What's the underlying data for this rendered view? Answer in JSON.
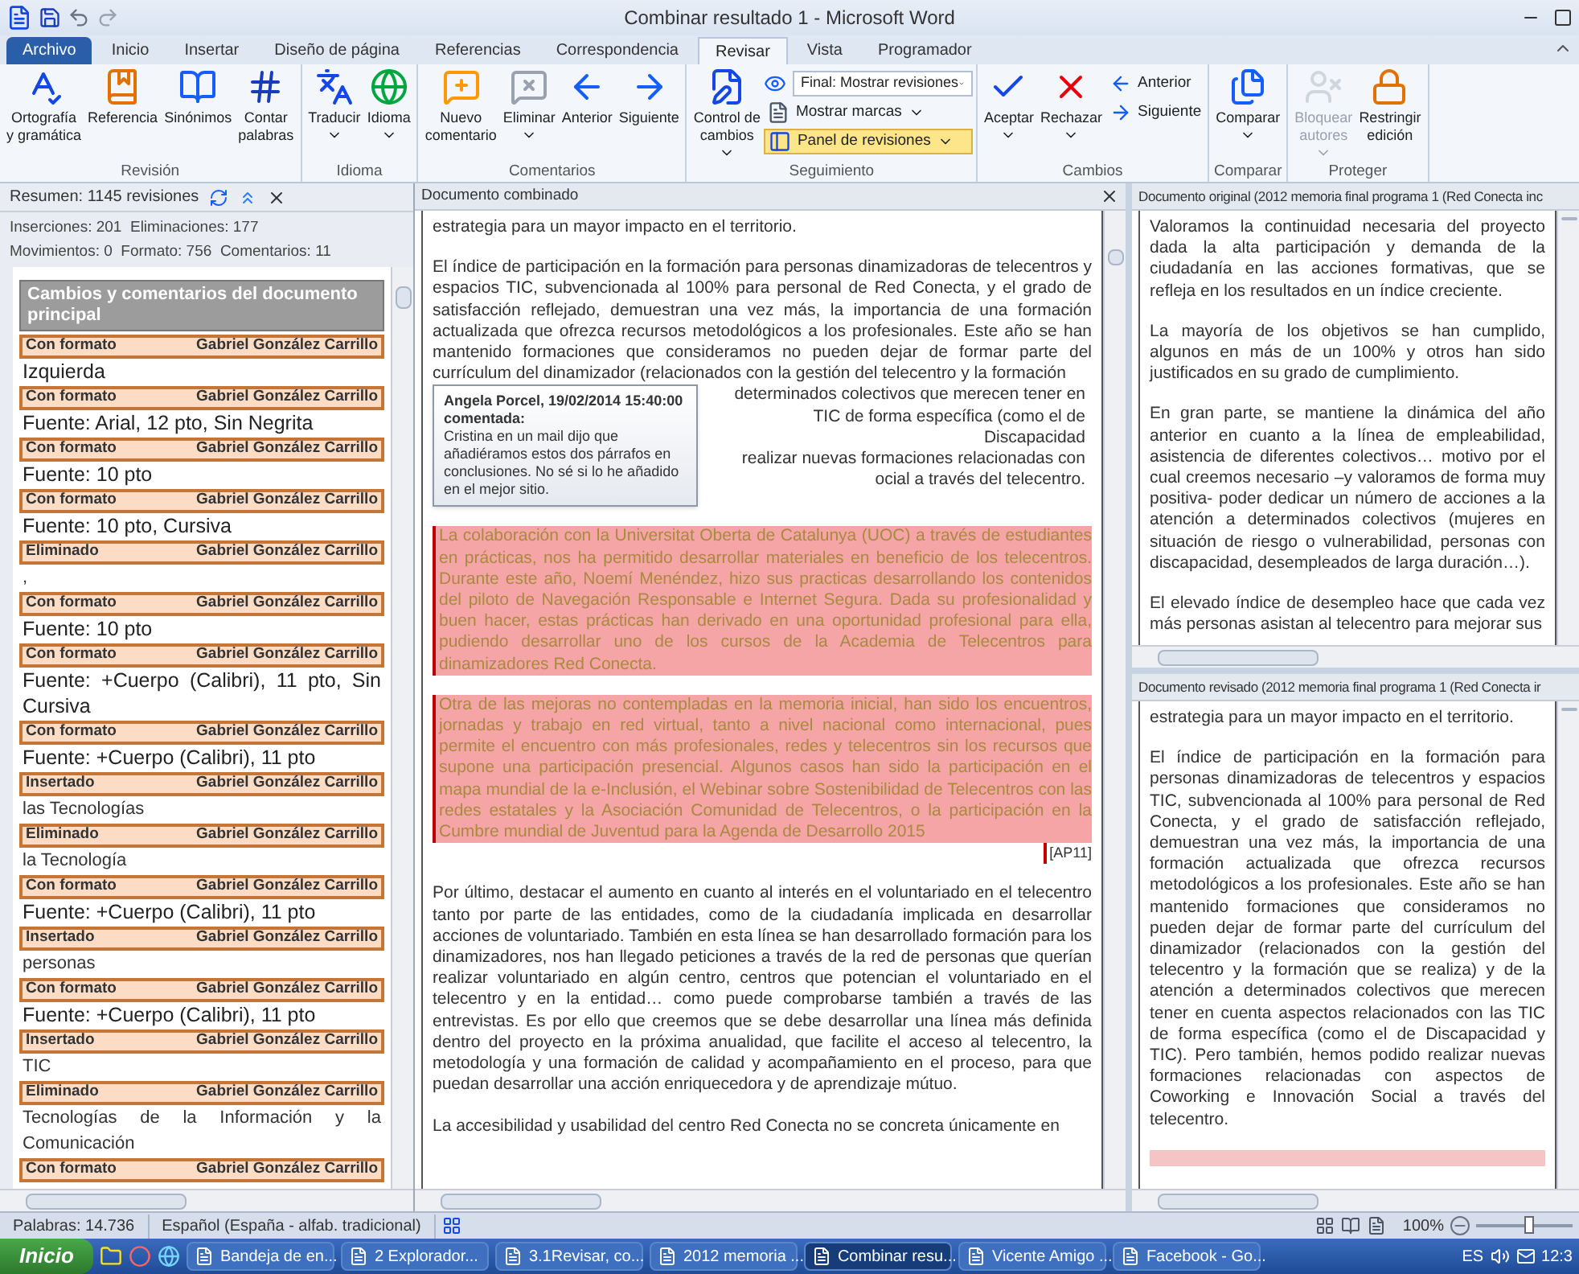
{
  "window": {
    "title": "Combinar resultado 1 - Microsoft Word"
  },
  "ribbon_tabs": [
    {
      "label": "Archivo",
      "kind": "file",
      "selected": false
    },
    {
      "label": "Inicio",
      "kind": "tab",
      "selected": false
    },
    {
      "label": "Insertar",
      "kind": "tab",
      "selected": false
    },
    {
      "label": "Diseño de página",
      "kind": "tab",
      "selected": false
    },
    {
      "label": "Referencias",
      "kind": "tab",
      "selected": false
    },
    {
      "label": "Correspondencia",
      "kind": "tab",
      "selected": false
    },
    {
      "label": "Revisar",
      "kind": "tab",
      "selected": true
    },
    {
      "label": "Vista",
      "kind": "tab",
      "selected": false
    },
    {
      "label": "Programador",
      "kind": "tab",
      "selected": false
    }
  ],
  "ribbon_groups": [
    {
      "name": "Revisión",
      "buttons": [
        {
          "kind": "large",
          "label": "Ortografía\ny gramática",
          "dropdown": false,
          "disabled": false
        },
        {
          "kind": "large",
          "label": "Referencia",
          "dropdown": false,
          "disabled": false
        },
        {
          "kind": "large",
          "label": "Sinónimos",
          "dropdown": false,
          "disabled": false
        },
        {
          "kind": "large",
          "label": "Contar\npalabras",
          "dropdown": false,
          "disabled": false
        }
      ]
    },
    {
      "name": "Idioma",
      "buttons": [
        {
          "kind": "large",
          "label": "Traducir",
          "dropdown": true,
          "disabled": false
        },
        {
          "kind": "large",
          "label": "Idioma",
          "dropdown": true,
          "disabled": false
        }
      ]
    },
    {
      "name": "Comentarios",
      "buttons": [
        {
          "kind": "large",
          "label": "Nuevo\ncomentario",
          "dropdown": false,
          "disabled": false
        },
        {
          "kind": "large",
          "label": "Eliminar",
          "dropdown": true,
          "disabled": false
        },
        {
          "kind": "large",
          "label": "Anterior",
          "dropdown": false,
          "disabled": false
        },
        {
          "kind": "large",
          "label": "Siguiente",
          "dropdown": false,
          "disabled": false
        }
      ]
    },
    {
      "name": "Seguimiento",
      "buttons": [
        {
          "kind": "large",
          "label": "Control de\ncambios",
          "dropdown": true,
          "disabled": false
        },
        {
          "kind": "select",
          "label": "Final: Mostrar revisiones",
          "dropdown": true,
          "disabled": false
        },
        {
          "kind": "small",
          "label": "Mostrar marcas",
          "dropdown": true,
          "disabled": false
        },
        {
          "kind": "small",
          "label": "Panel de revisiones",
          "dropdown": true,
          "disabled": false,
          "selected": true
        }
      ]
    },
    {
      "name": "Cambios",
      "buttons": [
        {
          "kind": "large",
          "label": "Aceptar",
          "dropdown": true,
          "disabled": false
        },
        {
          "kind": "large",
          "label": "Rechazar",
          "dropdown": true,
          "disabled": false
        },
        {
          "kind": "small",
          "label": "Anterior",
          "dropdown": false,
          "disabled": false
        },
        {
          "kind": "small",
          "label": "Siguiente",
          "dropdown": false,
          "disabled": false
        }
      ]
    },
    {
      "name": "Comparar",
      "buttons": [
        {
          "kind": "large",
          "label": "Comparar",
          "dropdown": true,
          "disabled": false
        }
      ]
    },
    {
      "name": "Proteger",
      "buttons": [
        {
          "kind": "large",
          "label": "Bloquear\nautores",
          "dropdown": true,
          "disabled": true
        },
        {
          "kind": "large",
          "label": "Restringir\nedición",
          "dropdown": false,
          "disabled": false
        }
      ]
    }
  ],
  "review_pane": {
    "summary": "Resumen: 1145 revisiones",
    "counts": [
      "Inserciones: 201  Eliminaciones: 177",
      "Movimientos: 0  Formato: 756  Comentarios: 11"
    ],
    "section_title": "Cambios y comentarios del documento principal",
    "revisions": [
      {
        "kind": "format",
        "type": "Con formato",
        "author": "Gabriel González Carrillo",
        "text": "Izquierda"
      },
      {
        "kind": "format",
        "type": "Con formato",
        "author": "Gabriel González Carrillo",
        "text": "Fuente: Arial, 12 pto, Sin Negrita"
      },
      {
        "kind": "format",
        "type": "Con formato",
        "author": "Gabriel González Carrillo",
        "text": "Fuente: 10 pto"
      },
      {
        "kind": "format",
        "type": "Con formato",
        "author": "Gabriel González Carrillo",
        "text": "Fuente: 10 pto, Cursiva"
      },
      {
        "kind": "delete",
        "type": "Eliminado",
        "author": "Gabriel González Carrillo",
        "text": ","
      },
      {
        "kind": "format",
        "type": "Con formato",
        "author": "Gabriel González Carrillo",
        "text": "Fuente: 10 pto"
      },
      {
        "kind": "format",
        "type": "Con formato",
        "author": "Gabriel González Carrillo",
        "text": "Fuente: +Cuerpo (Calibri), 11 pto, Sin Cursiva"
      },
      {
        "kind": "format",
        "type": "Con formato",
        "author": "Gabriel González Carrillo",
        "text": "Fuente: +Cuerpo (Calibri), 11 pto"
      },
      {
        "kind": "insert",
        "type": "Insertado",
        "author": "Gabriel González Carrillo",
        "text": "las Tecnologías"
      },
      {
        "kind": "delete",
        "type": "Eliminado",
        "author": "Gabriel González Carrillo",
        "text": "la Tecnología"
      },
      {
        "kind": "format",
        "type": "Con formato",
        "author": "Gabriel González Carrillo",
        "text": "Fuente: +Cuerpo (Calibri), 11 pto"
      },
      {
        "kind": "insert",
        "type": "Insertado",
        "author": "Gabriel González Carrillo",
        "text": "personas"
      },
      {
        "kind": "format",
        "type": "Con formato",
        "author": "Gabriel González Carrillo",
        "text": "Fuente: +Cuerpo (Calibri), 11 pto"
      },
      {
        "kind": "insert",
        "type": "Insertado",
        "author": "Gabriel González Carrillo",
        "text": "TIC"
      },
      {
        "kind": "delete",
        "type": "Eliminado",
        "author": "Gabriel González Carrillo",
        "text": "Tecnologías de la Información y la Comunicación"
      },
      {
        "kind": "format",
        "type": "Con formato",
        "author": "Gabriel González Carrillo"
      }
    ]
  },
  "combined_document": {
    "title": "Documento combinado",
    "paragraphs": [
      {
        "kind": "normal",
        "text": "estrategia para un mayor impacto en el territorio."
      },
      {
        "kind": "commented",
        "text": "El índice de participación en la formación para personas dinamizadoras de telecentros y espacios TIC, subvencionada al 100% para personal de Red Conecta, y el grado de satisfacción reflejado, demuestran una vez más, la importancia de una formación actualizada que ofrezca recursos metodológicos a los profesionales. Este año se han mantenido formaciones que consideramos no pueden dejar de formar parte del currículum del dinamizador (relacionados con la gestión del telecentro y la formación",
        "tail_lines": [
          "determinados colectivos que merecen tener en",
          "TIC de forma específica (como el de Discapacidad",
          "realizar nuevas formaciones relacionadas con",
          "ocial a través del telecentro."
        ],
        "comment": {
          "author": "Angela Porcel, 19/02/2014 15:40:00",
          "label": "comentada:",
          "text": "Cristina en un mail dijo que añadiéramos estos dos párrafos en conclusiones. No sé si lo he añadido en el mejor sitio."
        }
      },
      {
        "kind": "deleted",
        "text": "La colaboración con la Universitat Oberta de Catalunya (UOC) a través de estudiantes en prácticas, nos ha permitido desarrollar materiales en beneficio de los telecentros. Durante este año, Noemí Menéndez,  hizo sus practicas desarrollando los contenidos del piloto de Navegación Responsable e Internet Segura. Dada su profesionalidad y buen hacer, estas prácticas han derivado en una oportunidad profesional para ella, pudiendo desarrollar uno de los cursos de la Academia de Telecentros para dinamizadores Red Conecta."
      },
      {
        "kind": "deleted",
        "text": "Otra de las mejoras no contempladas en la memoria inicial, han sido los encuentros, jornadas y trabajo en red virtual, tanto a nivel nacional como internacional, pues permite el encuentro con más profesionales, redes y telecentros sin los recursos que supone una participación presencial. Algunos casos han sido la participación en el mapa mundial de la e-Inclusión, el Webinar sobre Sostenibilidad de Telecentros con las redes estatales y la Asociación Comunidad de Telecentros, o la participación en la Cumbre mundial de Juventud para la Agenda de Desarrollo 2015",
        "mark": "[AP11]"
      },
      {
        "kind": "normal",
        "text": "Por último, destacar el aumento en cuanto al interés en el voluntariado en el telecentro tanto por parte de las entidades, como de la ciudadanía implicada en desarrollar acciones de voluntariado. También en esta línea se han desarrollado formación para los dinamizadores, nos han llegado peticiones a través de la red de personas que querían realizar voluntariado en algún centro, centros que potencian el voluntariado en el telecentro y en la entidad… como puede comprobarse también a través de las entrevistas. Es por ello que creemos  que se debe desarrollar una línea más definida dentro del proyecto en la próxima anualidad, que facilite el acceso al telecentro, la metodología y una formación de calidad y acompañamiento en el proceso, para que puedan desarrollar una acción enriquecedora y de aprendizaje mútuo."
      },
      {
        "kind": "normal",
        "text": "La accesibilidad y usabilidad del centro Red Conecta no se concreta únicamente en"
      }
    ]
  },
  "original_document": {
    "title": "Documento original (2012 memoria final programa 1 (Red Conecta inc",
    "paragraphs": [
      {
        "kind": "normal",
        "text": "Valoramos la continuidad necesaria del proyecto dada la alta participación y demanda de la ciudadanía en las acciones formativas, que se refleja en los resultados en un índice creciente."
      },
      {
        "kind": "normal",
        "text": "La mayoría de los objetivos se han cumplido, algunos en más de un 100%  y otros han sido justificados en su grado de cumplimiento."
      },
      {
        "kind": "normal",
        "text": "En gran parte, se mantiene la dinámica del año anterior en cuanto a la línea de empleabilidad, asistencia de diferentes colectivos… motivo por el cual creemos necesario –y valoramos de forma muy positiva- poder dedicar un número de acciones a la atención a determinados colectivos (mujeres en situación de riesgo o vulnerabilidad, personas con discapacidad, desempleados de larga duración…)."
      },
      {
        "kind": "normal",
        "text": "El elevado índice de desempleo hace que cada vez más personas asistan al telecentro para mejorar sus"
      }
    ]
  },
  "revised_document": {
    "title": "Documento revisado (2012 memoria final programa 1 (Red Conecta ir",
    "paragraphs": [
      {
        "kind": "normal",
        "text": "estrategia para un mayor impacto en el territorio."
      },
      {
        "kind": "normal",
        "text": "El índice de participación en la formación para personas dinamizadoras de telecentros y espacios TIC, subvencionada al 100% para personal de Red Conecta, y el grado de satisfacción reflejado, demuestran una vez más, la importancia de una formación actualizada que ofrezca recursos metodológicos a los profesionales. Este año se han mantenido formaciones que consideramos no pueden dejar de formar parte del currículum del dinamizador (relacionados con la gestión del telecentro y la formación que se realiza) y de la atención a determinados colectivos que merecen tener en cuenta aspectos relacionados con las TIC de forma específica (como el de Discapacidad y TIC). Pero también, hemos podido realizar nuevas formaciones relacionadas con aspectos de Coworking e Innovación Social a través del telecentro."
      },
      {
        "kind": "deleted_strip"
      }
    ]
  },
  "status_bar": {
    "words": "Palabras: 14.736",
    "language": "Español (España - alfab. tradicional)",
    "zoom": "100%",
    "level": 0.55
  },
  "taskbar": {
    "start": "Inicio",
    "buttons": [
      {
        "label": "Bandeja de en...",
        "selected": false
      },
      {
        "label": "2 Explorador...",
        "selected": false
      },
      {
        "label": "3.1Revisar, co...",
        "selected": false
      },
      {
        "label": "2012 memoria ...",
        "selected": false
      },
      {
        "label": "Combinar resu...",
        "selected": true
      },
      {
        "label": "Vicente Amigo ...",
        "selected": false
      },
      {
        "label": "Facebook - Go...",
        "selected": false
      }
    ],
    "language": "ES",
    "time": "12:3"
  }
}
